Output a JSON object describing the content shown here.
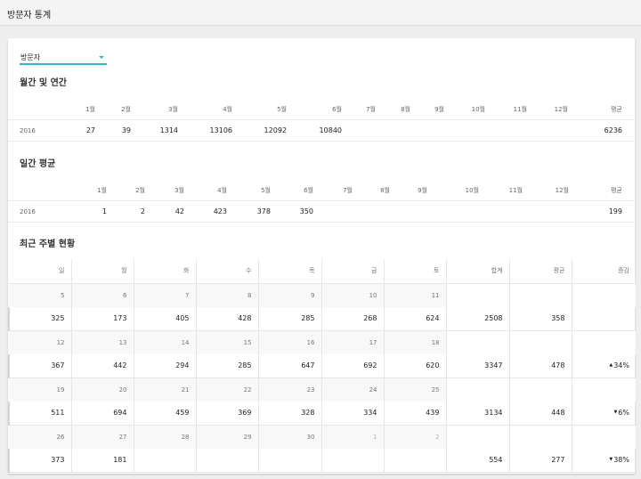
{
  "header": {
    "title": "방문자 통계"
  },
  "filter": {
    "selected": "방문자"
  },
  "monthly": {
    "title": "월간 및 연간",
    "columns": [
      "",
      "1월",
      "2월",
      "3월",
      "4월",
      "5월",
      "6월",
      "7월",
      "8월",
      "9월",
      "10월",
      "11월",
      "12월",
      "평균"
    ],
    "rows": [
      [
        "2016",
        "27",
        "39",
        "1314",
        "13106",
        "12092",
        "10840",
        "",
        "",
        "",
        "",
        "",
        "",
        "6236"
      ]
    ]
  },
  "daily": {
    "title": "일간 평균",
    "columns": [
      "",
      "1월",
      "2월",
      "3월",
      "4월",
      "5월",
      "6월",
      "7월",
      "8월",
      "9월",
      "10월",
      "11월",
      "12월",
      "평균"
    ],
    "rows": [
      [
        "2016",
        "1",
        "2",
        "42",
        "423",
        "378",
        "350",
        "",
        "",
        "",
        "",
        "",
        "",
        "199"
      ]
    ]
  },
  "weekly": {
    "title": "최근 주별 현황",
    "columns": [
      "일",
      "월",
      "화",
      "수",
      "목",
      "금",
      "토",
      "합계",
      "평균",
      "증감"
    ],
    "weeks": [
      {
        "dates": [
          "5",
          "6",
          "7",
          "8",
          "9",
          "10",
          "11"
        ],
        "values": [
          "325",
          "173",
          "405",
          "428",
          "285",
          "268",
          "624"
        ],
        "total": "2508",
        "avg": "358",
        "change": "",
        "trend": ""
      },
      {
        "dates": [
          "12",
          "13",
          "14",
          "15",
          "16",
          "17",
          "18"
        ],
        "values": [
          "367",
          "442",
          "294",
          "285",
          "647",
          "692",
          "620"
        ],
        "total": "3347",
        "avg": "478",
        "change": "34%",
        "trend": "up"
      },
      {
        "dates": [
          "19",
          "20",
          "21",
          "22",
          "23",
          "24",
          "25"
        ],
        "values": [
          "511",
          "694",
          "459",
          "369",
          "328",
          "334",
          "439"
        ],
        "total": "3134",
        "avg": "448",
        "change": "6%",
        "trend": "down"
      },
      {
        "dates": [
          "26",
          "27",
          "28",
          "29",
          "30",
          "1",
          "2"
        ],
        "values": [
          "373",
          "181",
          "",
          "",
          "",
          "",
          ""
        ],
        "total": "554",
        "avg": "277",
        "change": "38%",
        "trend": "down"
      }
    ]
  },
  "colors": {
    "accent": "#3bb0c9",
    "up": "#2aa9c4",
    "down": "#e05360"
  }
}
